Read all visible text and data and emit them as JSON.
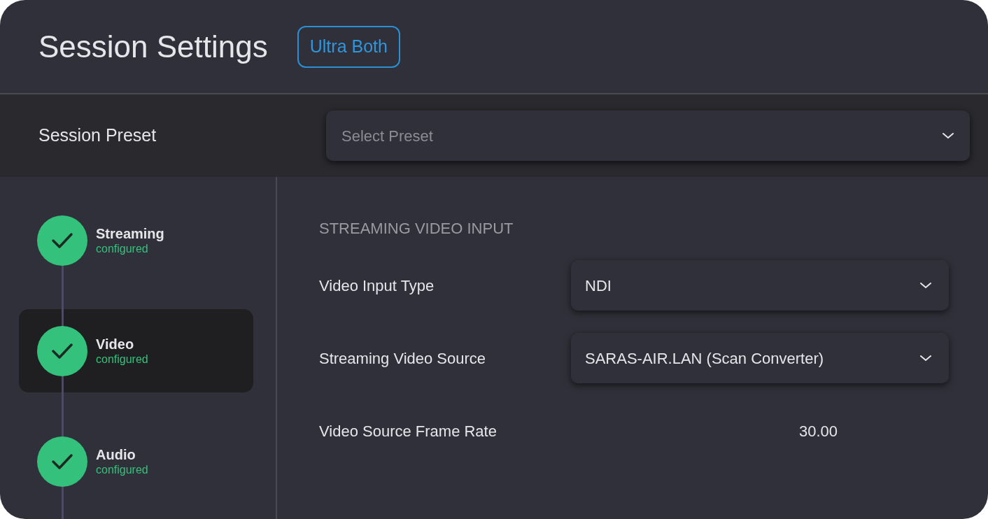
{
  "title": "Session Settings",
  "badge": "Ultra Both",
  "preset": {
    "label": "Session Preset",
    "placeholder": "Select Preset"
  },
  "steps": [
    {
      "title": "Streaming",
      "status": "configured",
      "completed": true,
      "selected": false
    },
    {
      "title": "Video",
      "status": "configured",
      "completed": true,
      "selected": true
    },
    {
      "title": "Audio",
      "status": "configured",
      "completed": true,
      "selected": false
    }
  ],
  "section": {
    "heading": "STREAMING VIDEO INPUT",
    "fields": [
      {
        "kind": "select",
        "label": "Video Input Type",
        "value": "NDI"
      },
      {
        "kind": "select",
        "label": "Streaming Video Source",
        "value": "SARAS-AIR.LAN (Scan Converter)"
      },
      {
        "kind": "readonly",
        "label": "Video Source Frame Rate",
        "value": "30.00"
      }
    ]
  }
}
